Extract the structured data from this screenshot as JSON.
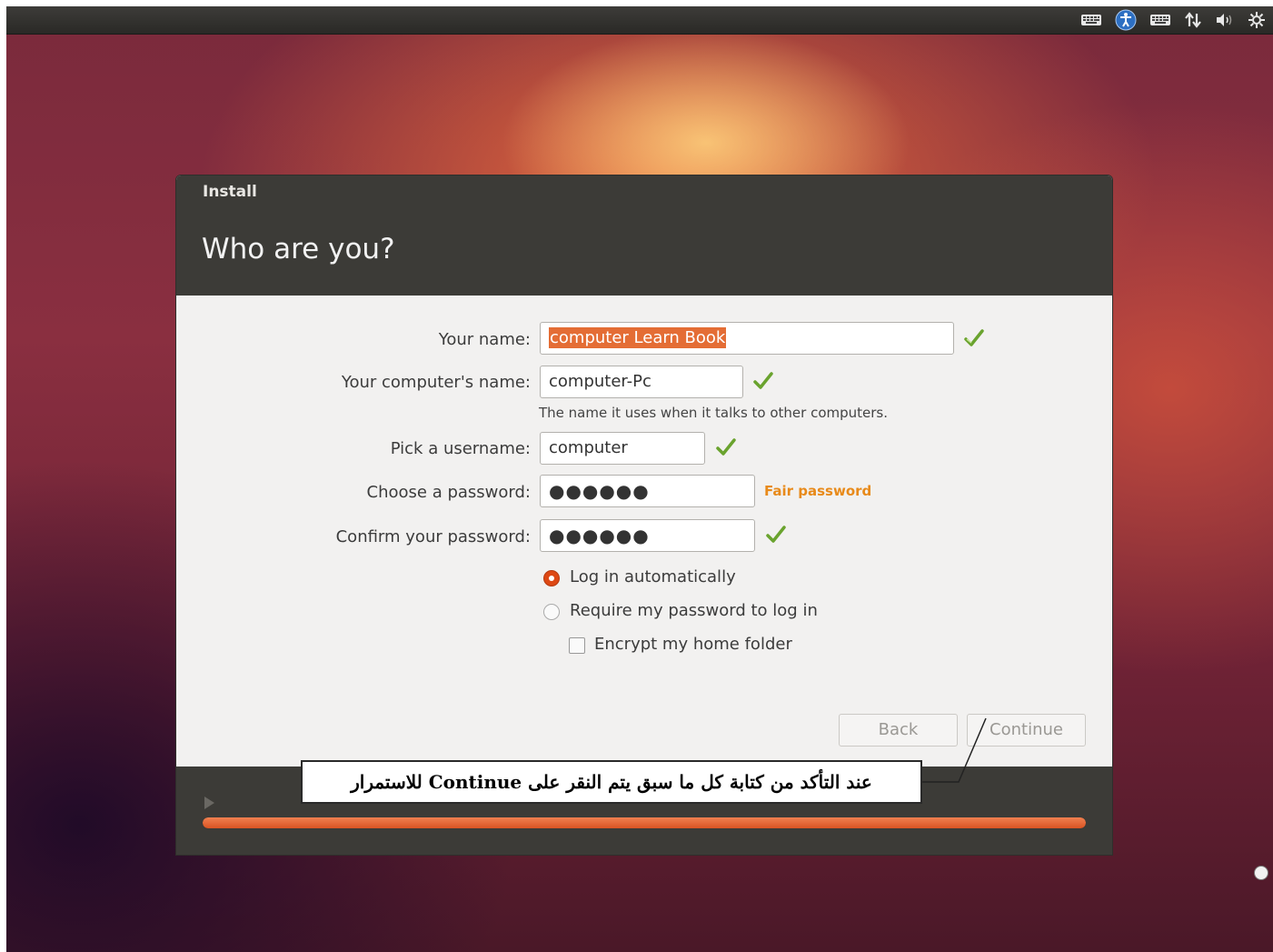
{
  "window": {
    "title": "Install"
  },
  "page": {
    "heading": "Who are you?"
  },
  "form": {
    "name_label": "Your name:",
    "name_value": "computer Learn Book",
    "computer_label": "Your computer's name:",
    "computer_value": "computer-Pc",
    "computer_hint": "The name it uses when it talks to other computers.",
    "username_label": "Pick a username:",
    "username_value": "computer",
    "password_label": "Choose a password:",
    "password_value": "●●●●●●",
    "password_strength": "Fair password",
    "confirm_label": "Confirm your password:",
    "confirm_value": "●●●●●●",
    "login_auto_label": "Log in automatically",
    "login_auto_selected": true,
    "login_require_label": "Require my password to log in",
    "encrypt_label": "Encrypt my home folder",
    "encrypt_checked": false
  },
  "buttons": {
    "back_label": "Back",
    "continue_label": "Continue"
  },
  "progress": {
    "fraction": 1.0
  },
  "annotation": {
    "text": "عند التأكد من كتابة كل ما سبق يتم النقر على Continue للاستمرار"
  },
  "tray": {
    "icons": [
      "keyboard-icon",
      "accessibility-icon",
      "keyboard-layout-icon",
      "network-icon",
      "volume-icon",
      "settings-icon"
    ]
  },
  "colors": {
    "accent": "#dd4814",
    "header": "#3c3b37",
    "strength": "#e88a1a",
    "check": "#7bb33a"
  }
}
